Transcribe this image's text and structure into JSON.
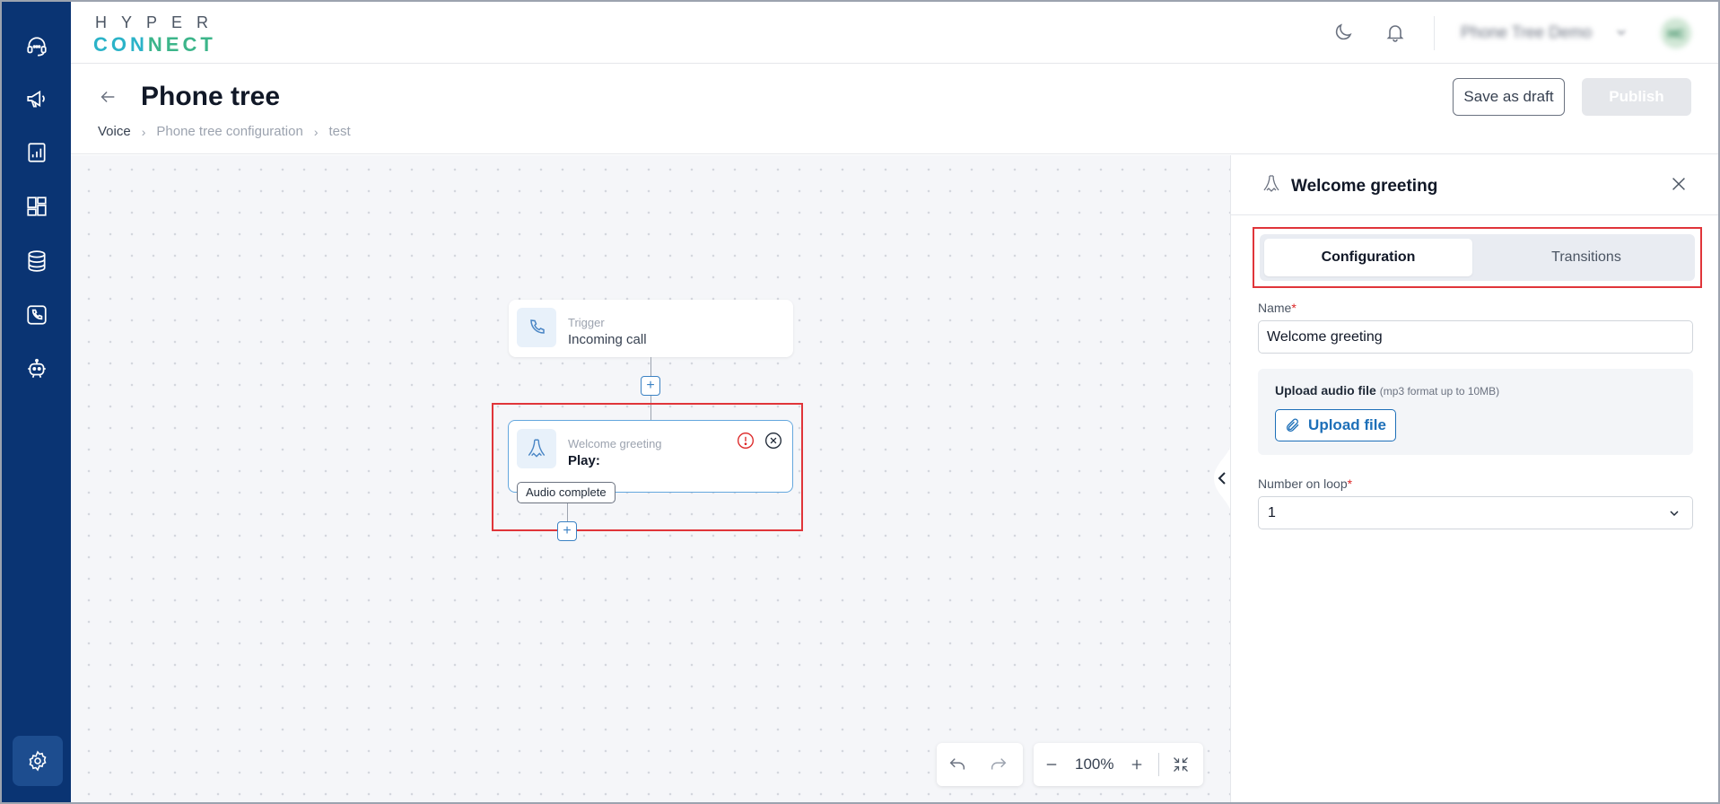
{
  "app": {
    "logo_top": "HYPER",
    "logo_bottom_a": "CON",
    "logo_bottom_b": "NECT",
    "org_name": "Phone Tree Demo",
    "avatar_initials": "HC"
  },
  "page": {
    "title": "Phone tree",
    "breadcrumb": [
      "Voice",
      "Phone tree configuration",
      "test"
    ],
    "save_draft_label": "Save as draft",
    "publish_label": "Publish"
  },
  "canvas": {
    "trigger_node": {
      "kind": "Trigger",
      "value": "Incoming call"
    },
    "greeting_node": {
      "kind": "Welcome greeting",
      "value": "Play:"
    },
    "transition_label": "Audio complete",
    "zoom_label": "100%"
  },
  "panel": {
    "title": "Welcome greeting",
    "tabs": [
      {
        "label": "Configuration",
        "active": true
      },
      {
        "label": "Transitions",
        "active": false
      }
    ],
    "name_label": "Name",
    "required_mark": "*",
    "name_value": "Welcome greeting",
    "upload_title": "Upload audio file",
    "upload_hint": "(mp3 format up to 10MB)",
    "upload_button": "Upload file",
    "loop_label": "Number on loop",
    "loop_value": "1"
  },
  "colors": {
    "sidebar": "#0a3473",
    "accent": "#1d6fb8",
    "highlight": "#e0353a",
    "error": "#dc2626"
  },
  "icons": {
    "sidebar": [
      "support-agent-icon",
      "megaphone-icon",
      "report-icon",
      "dashboard-icon",
      "database-icon",
      "phone-icon",
      "bot-icon",
      "settings-icon"
    ]
  }
}
